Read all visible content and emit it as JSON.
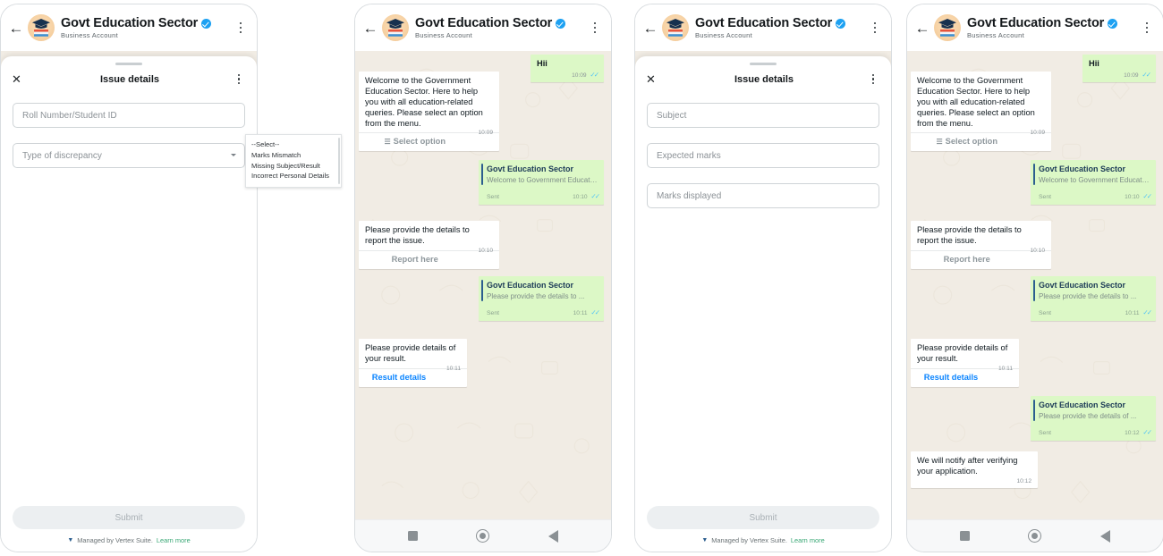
{
  "app": {
    "header": {
      "title": "Govt Education Sector",
      "subtitle": "Business Account",
      "verified_badge": "verified-badge",
      "back_icon": "back-arrow-icon",
      "menu_icon": "kebab-menu-icon",
      "avatar_icon": "graduation-cap-avatar"
    },
    "nav": {
      "recents_label": "recents-square",
      "home_label": "home-circle",
      "back_label": "back-triangle"
    },
    "colors": {
      "outgoing_bubble": "#dcf8c6",
      "incoming_bubble": "#ffffff",
      "chat_background": "#f1ece4",
      "verified_blue": "#1da1f2",
      "link_blue": "#0a84ff",
      "ticks_blue": "#4fc3f7",
      "card_accent": "#2c5e8f",
      "learn_more_green": "#3aa876"
    }
  },
  "panels": [
    {
      "id": "panel-1",
      "type": "form",
      "sheet": {
        "title": "Issue details",
        "close_icon": "close-x-icon",
        "menu_icon": "kebab-menu-icon",
        "fields": [
          {
            "name": "roll-number",
            "placeholder": "Roll Number/Student ID",
            "value": "",
            "type": "text"
          },
          {
            "name": "type-of-discrepancy",
            "placeholder": "Type of discrepancy",
            "value": "",
            "type": "select"
          }
        ],
        "submit_label": "Submit",
        "footer_text": "Managed by Vertex Suite.",
        "footer_link": "Learn more"
      },
      "dropdown": {
        "open": true,
        "options": [
          "--Select--",
          "Marks Mismatch",
          "Missing Subject/Result",
          "Incorrect Personal Details"
        ]
      }
    },
    {
      "id": "panel-2",
      "type": "chat",
      "messages": [
        {
          "kind": "out-text",
          "text": "Hii",
          "time": "10:09",
          "ticks": "✓✓"
        },
        {
          "kind": "in-text",
          "text": "Welcome to the Government Education Sector. Here to help you with all education-related queries. Please select an option from the menu.",
          "time": "10:09",
          "action": "Select option",
          "action_icon": "list-icon"
        },
        {
          "kind": "out-card",
          "title": "Govt Education Sector",
          "subtitle": "Welcome to Government Education...",
          "sent_label": "Sent",
          "time": "10:10",
          "ticks": "✓✓"
        },
        {
          "kind": "in-text",
          "text": "Please provide the details to report the issue.",
          "time": "10:10",
          "action": "Report here"
        },
        {
          "kind": "out-card",
          "title": "Govt Education Sector",
          "subtitle": "Please provide the details to ...",
          "sent_label": "Sent",
          "time": "10:11",
          "ticks": "✓✓"
        },
        {
          "kind": "in-text",
          "text": "Please provide details of your result.",
          "time": "10:11",
          "action": "Result details",
          "action_link": true
        }
      ]
    },
    {
      "id": "panel-3",
      "type": "form",
      "sheet": {
        "title": "Issue details",
        "close_icon": "close-x-icon",
        "menu_icon": "kebab-menu-icon",
        "fields": [
          {
            "name": "subject",
            "placeholder": "Subject",
            "value": "",
            "type": "text"
          },
          {
            "name": "expected-marks",
            "placeholder": "Expected marks",
            "value": "",
            "type": "text"
          },
          {
            "name": "marks-displayed",
            "placeholder": "Marks displayed",
            "value": "",
            "type": "text"
          }
        ],
        "submit_label": "Submit",
        "footer_text": "Managed by Vertex Suite.",
        "footer_link": "Learn more"
      },
      "dropdown": {
        "open": false,
        "options": []
      }
    },
    {
      "id": "panel-4",
      "type": "chat",
      "messages": [
        {
          "kind": "out-text",
          "text": "Hii",
          "time": "10:09",
          "ticks": "✓✓"
        },
        {
          "kind": "in-text",
          "text": "Welcome to the Government Education Sector. Here to help you with all education-related queries. Please select an option from the menu.",
          "time": "10:09",
          "action": "Select option",
          "action_icon": "list-icon"
        },
        {
          "kind": "out-card",
          "title": "Govt Education Sector",
          "subtitle": "Welcome to Government Education...",
          "sent_label": "Sent",
          "time": "10:10",
          "ticks": "✓✓"
        },
        {
          "kind": "in-text",
          "text": "Please provide the details to report the issue.",
          "time": "10:10",
          "action": "Report here"
        },
        {
          "kind": "out-card",
          "title": "Govt Education Sector",
          "subtitle": "Please provide the details to ...",
          "sent_label": "Sent",
          "time": "10:11",
          "ticks": "✓✓"
        },
        {
          "kind": "in-text",
          "text": "Please provide details of your result.",
          "time": "10:11",
          "action": "Result details",
          "action_link": true
        },
        {
          "kind": "out-card",
          "title": "Govt Education Sector",
          "subtitle": "Please provide the details of ...",
          "sent_label": "Sent",
          "time": "10:12",
          "ticks": "✓✓"
        },
        {
          "kind": "in-text",
          "text": "We will notify after verifying your application.",
          "time": "10:12"
        }
      ]
    }
  ]
}
